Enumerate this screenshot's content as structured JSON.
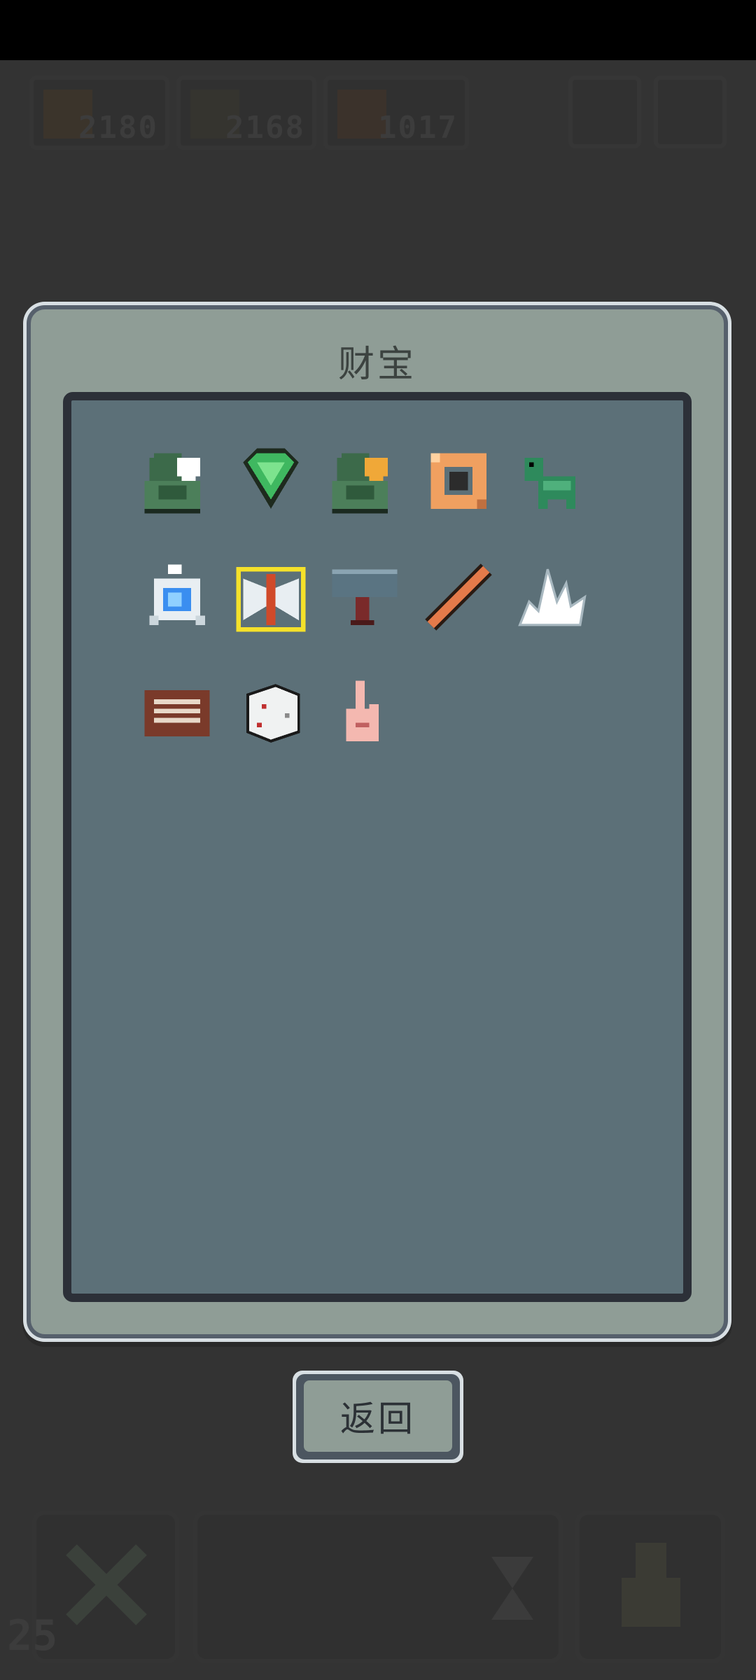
{
  "hud": {
    "stats": [
      {
        "value": "2180",
        "icon": "coin-icon"
      },
      {
        "value": "2168",
        "icon": "coin-icon"
      },
      {
        "value": "1017",
        "icon": "coin-icon"
      }
    ],
    "level": "25"
  },
  "panel": {
    "title": "财宝",
    "items": [
      {
        "name": "green-hood-white-heart-icon"
      },
      {
        "name": "green-gem-icon"
      },
      {
        "name": "green-hood-gold-heart-icon"
      },
      {
        "name": "orange-ring-icon"
      },
      {
        "name": "green-turtle-icon"
      },
      {
        "name": "blue-crystal-amulet-icon"
      },
      {
        "name": "double-axe-icon",
        "selected": true
      },
      {
        "name": "war-hammer-icon"
      },
      {
        "name": "orange-stick-icon"
      },
      {
        "name": "white-crystal-icon"
      },
      {
        "name": "brown-chest-icon"
      },
      {
        "name": "white-dice-icon"
      },
      {
        "name": "finger-icon"
      }
    ]
  },
  "buttons": {
    "back_label": "返回"
  }
}
